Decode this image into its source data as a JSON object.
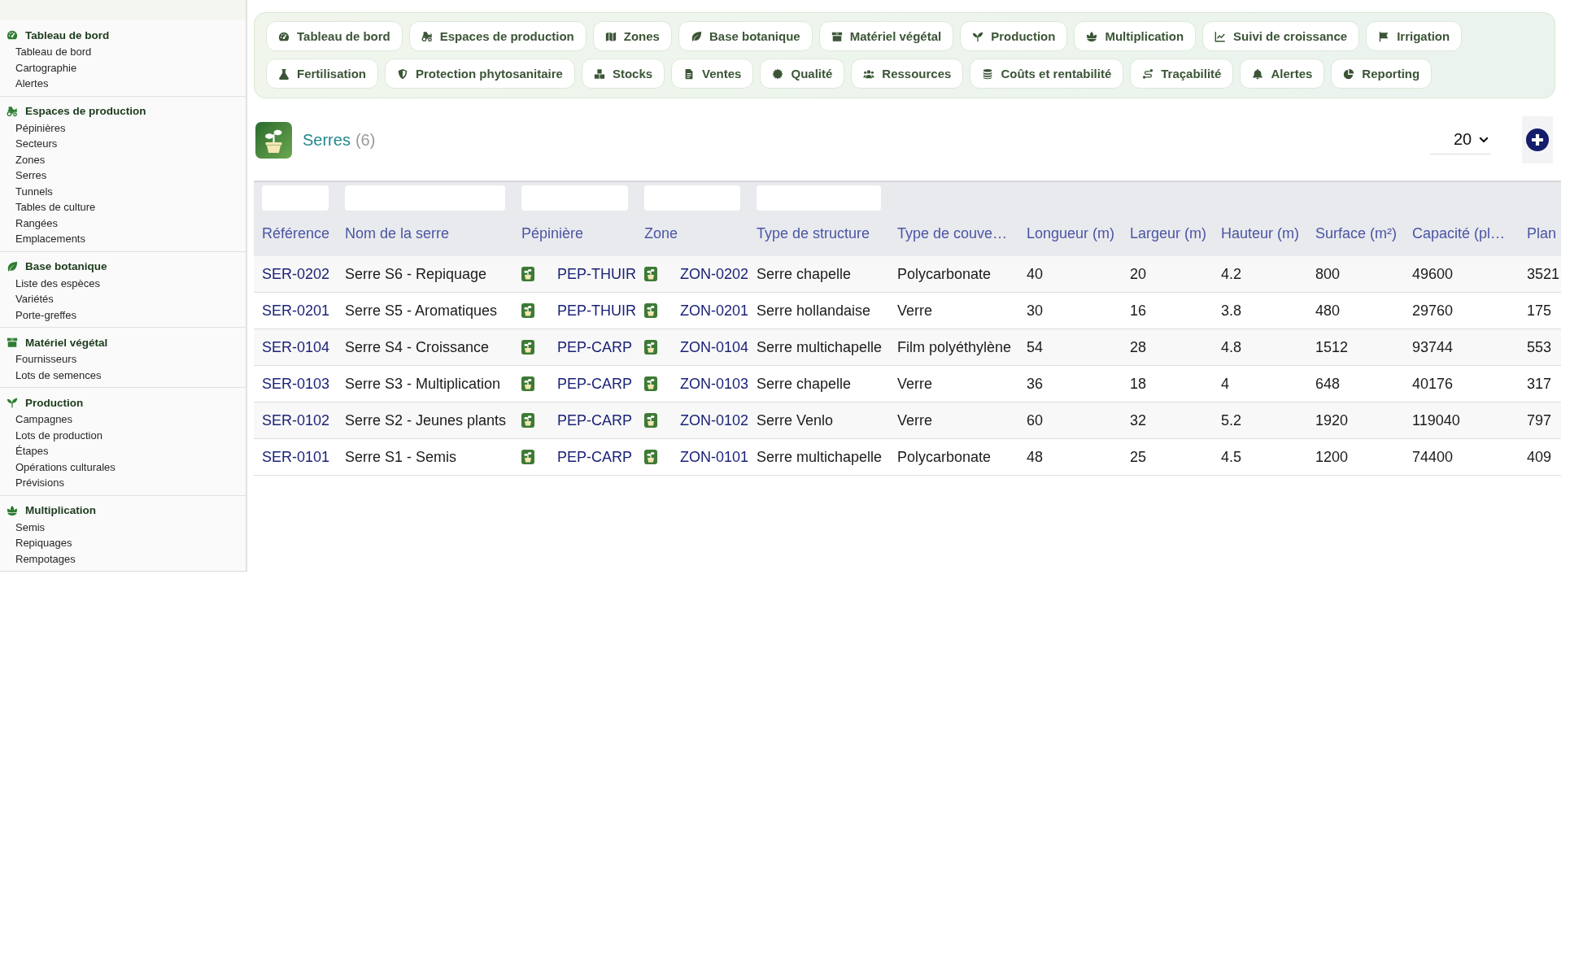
{
  "sidebar": {
    "sections": [
      {
        "title": "Tableau de bord",
        "items": [
          "Tableau de bord",
          "Cartographie",
          "Alertes"
        ]
      },
      {
        "title": "Espaces de production",
        "items": [
          "Pépinières",
          "Secteurs",
          "Zones",
          "Serres",
          "Tunnels",
          "Tables de culture",
          "Rangées",
          "Emplacements"
        ]
      },
      {
        "title": "Base botanique",
        "items": [
          "Liste des espèces",
          "Variétés",
          "Porte-greffes"
        ]
      },
      {
        "title": "Matériel végétal",
        "items": [
          "Fournisseurs",
          "Lots de semences"
        ]
      },
      {
        "title": "Production",
        "items": [
          "Campagnes",
          "Lots de production",
          "Étapes",
          "Opérations culturales",
          "Prévisions"
        ]
      },
      {
        "title": "Multiplication",
        "items": [
          "Semis",
          "Repiquages",
          "Rempotages"
        ]
      }
    ]
  },
  "nav": {
    "tabs": [
      "Tableau de bord",
      "Espaces de production",
      "Zones",
      "Base botanique",
      "Matériel végétal",
      "Production",
      "Multiplication",
      "Suivi de croissance",
      "Irrigation",
      "Fertilisation",
      "Protection phytosanitaire",
      "Stocks",
      "Ventes",
      "Qualité",
      "Ressources",
      "Coûts et rentabilité",
      "Traçabilité",
      "Alertes",
      "Reporting"
    ]
  },
  "header": {
    "title": "Serres",
    "count": "(6)",
    "page_size": "20"
  },
  "table": {
    "columns": [
      {
        "label": "Référence",
        "kind": "link",
        "filter": true
      },
      {
        "label": "Nom de la serre",
        "kind": "text",
        "filter": true
      },
      {
        "label": "Pépinière",
        "kind": "icon_link",
        "filter": true
      },
      {
        "label": "Zone",
        "kind": "icon_link",
        "filter": true
      },
      {
        "label": "Type de structure",
        "kind": "text",
        "filter": true
      },
      {
        "label": "Type de couve…",
        "kind": "text",
        "filter": false
      },
      {
        "label": "Longueur (m)",
        "kind": "text",
        "filter": false
      },
      {
        "label": "Largeur (m)",
        "kind": "text",
        "filter": false
      },
      {
        "label": "Hauteur (m)",
        "kind": "text",
        "filter": false
      },
      {
        "label": "Surface (m²)",
        "kind": "text",
        "filter": false
      },
      {
        "label": "Capacité (pl…",
        "kind": "text",
        "filter": false
      },
      {
        "label": "Plan",
        "kind": "text",
        "filter": false
      }
    ],
    "rows": [
      [
        "SER-0202",
        "Serre S6 - Repiquage",
        "PEP-THUIR",
        "ZON-0202",
        "Serre chapelle",
        "Polycarbonate",
        "40",
        "20",
        "4.2",
        "800",
        "49600",
        "3521"
      ],
      [
        "SER-0201",
        "Serre S5 - Aromatiques",
        "PEP-THUIR",
        "ZON-0201",
        "Serre hollandaise",
        "Verre",
        "30",
        "16",
        "3.8",
        "480",
        "29760",
        "175"
      ],
      [
        "SER-0104",
        "Serre S4 - Croissance",
        "PEP-CARP",
        "ZON-0104",
        "Serre multichapelle",
        "Film polyéthylène",
        "54",
        "28",
        "4.8",
        "1512",
        "93744",
        "553"
      ],
      [
        "SER-0103",
        "Serre S3 - Multiplication",
        "PEP-CARP",
        "ZON-0103",
        "Serre chapelle",
        "Verre",
        "36",
        "18",
        "4",
        "648",
        "40176",
        "317"
      ],
      [
        "SER-0102",
        "Serre S2 - Jeunes plants",
        "PEP-CARP",
        "ZON-0102",
        "Serre Venlo",
        "Verre",
        "60",
        "32",
        "5.2",
        "1920",
        "119040",
        "797"
      ],
      [
        "SER-0101",
        "Serre S1 - Semis",
        "PEP-CARP",
        "ZON-0101",
        "Serre multichapelle",
        "Polycarbonate",
        "48",
        "25",
        "4.5",
        "1200",
        "74400",
        "409"
      ]
    ]
  }
}
